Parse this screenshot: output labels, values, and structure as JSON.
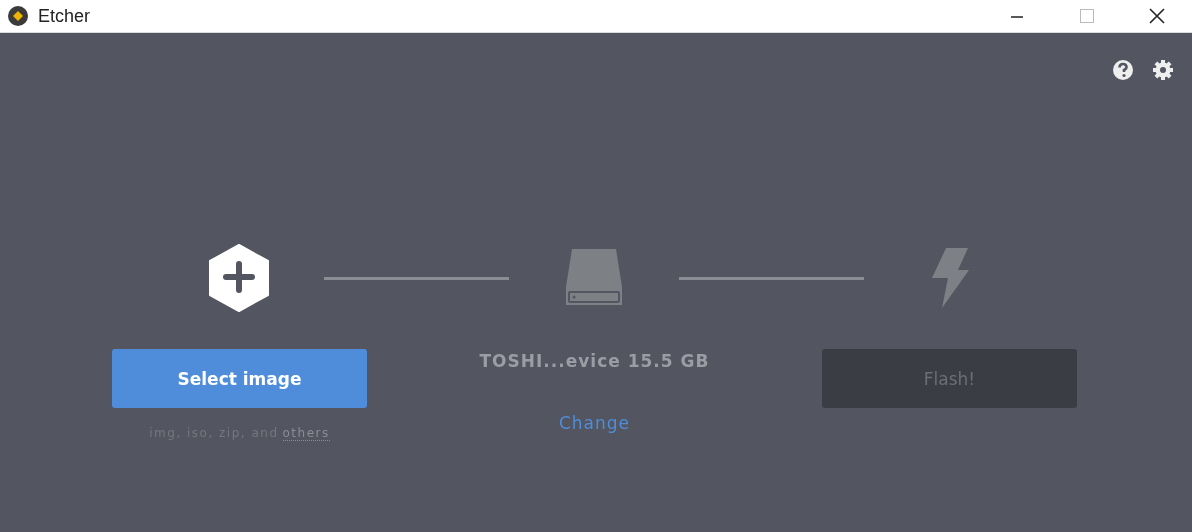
{
  "window": {
    "title": "Etcher"
  },
  "steps": [
    {
      "kind": "image",
      "button": "Select image",
      "disabled": false,
      "hint": "img, iso, zip, and",
      "hint_link": "others"
    },
    {
      "kind": "drive",
      "label": "TOSHI...evice 15.5 GB",
      "action": "Change"
    },
    {
      "kind": "flash",
      "button": "Flash!",
      "disabled": true
    }
  ]
}
